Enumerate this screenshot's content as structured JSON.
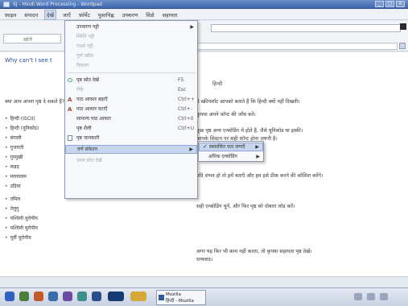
{
  "window": {
    "title": "SJ - Hindi Word Processing - Wordpad"
  },
  "menubar": {
    "items": [
      "फ़ाइल",
      "संपादन",
      "देखें",
      "जाएँ",
      "फ़ॉर्मेट",
      "पुस्तचिह्न",
      "उपकरण",
      "विंडो",
      "सहायता"
    ]
  },
  "toolbar": {
    "address_value": "",
    "search_placeholder": "खोजें"
  },
  "document": {
    "heading": "Why can't I see t",
    "subheading": "हिन्दी",
    "line_left": "क्या आप अपना पृष्ठ दे सकते हैं?",
    "paragraph_lines": [
      "ये स्क्रीनशॉट आपको बताते हैं कि हिन्दी क्यों नहीं दिखती।",
      "कृपया अपने फ़ॉन्ट की जाँच करें।",
      "कुछ पृष्ठ अन्य एन्कोडिंग में होते हैं, जैसे यूनिकोड या इस्की।",
      "आपके सिस्टम पर सही फ़ॉन्ट होना ज़रूरी है।",
      "यदि संभव हो तो हमें बताएँ और हम इसे ठीक करने की कोशिश करेंगे।",
      "सही एन्कोडिंग चुनें, और फिर पृष्ठ को दोबारा लोड करें।",
      "",
      "अगर यह फिर भी काम नहीं करता, तो कृपया सहायता पृष्ठ देखें।",
      "धन्यवाद।"
    ],
    "left_rows": [
      "हिन्दी (ISCII)",
      "हिन्दी (यूनिकोड)",
      "बंगाली",
      "गुजराती",
      "गुरमुखी",
      "कन्नड़",
      "मलयालम",
      "उड़िया",
      "तमिल",
      "तेलुगु",
      "पश्चिमी यूरोपीय",
      "पश्चिमी यूरोपीय",
      "पूर्वी यूरोपीय"
    ]
  },
  "view_menu": {
    "items": [
      {
        "label": "उपकरण पट्टी",
        "shortcut": "",
        "dim": false,
        "submenu": true
      },
      {
        "label": "स्थिति पट्टी",
        "shortcut": "",
        "dim": true,
        "submenu": false
      },
      {
        "label": "पार्श्व पट्टी",
        "shortcut": "",
        "dim": true,
        "submenu": false
      },
      {
        "label": "पूर्ण स्क्रीन",
        "shortcut": "",
        "dim": true,
        "submenu": false
      },
      {
        "label": "विकल्प",
        "shortcut": "",
        "dim": true,
        "submenu": false
      },
      {
        "label": "पृष्ठ स्रोत देखें",
        "shortcut": "F5",
        "dim": false,
        "submenu": false
      },
      {
        "label": "रोकें",
        "shortcut": "Esc",
        "dim": true,
        "submenu": false
      },
      {
        "label": "पाठ आकार बढ़ाएँ",
        "shortcut": "Ctrl++",
        "dim": false,
        "submenu": false
      },
      {
        "label": "पाठ आकार घटाएँ",
        "shortcut": "Ctrl+-",
        "dim": false,
        "submenu": false
      },
      {
        "label": "सामान्य पाठ आकार",
        "shortcut": "Ctrl+0",
        "dim": false,
        "submenu": false
      },
      {
        "label": "पृष्ठ शैली",
        "shortcut": "Ctrl+U",
        "dim": false,
        "submenu": false
      },
      {
        "label": "पृष्ठ जानकारी",
        "shortcut": "",
        "dim": false,
        "submenu": false
      },
      {
        "label": "वर्ण संकेतन",
        "shortcut": "",
        "dim": false,
        "submenu": true
      },
      {
        "label": "चयन स्रोत देखें",
        "shortcut": "",
        "dim": true,
        "submenu": false
      }
    ]
  },
  "encoding_submenu": {
    "items": [
      {
        "label": "स्वचालित पता लगाएँ",
        "checked": true
      },
      {
        "label": "अधिक एन्कोडिंग",
        "checked": false
      }
    ]
  },
  "taskbar": {
    "task_line1": "Mozilla",
    "task_line2": "हिन्दी - Mozilla",
    "clock": ""
  }
}
